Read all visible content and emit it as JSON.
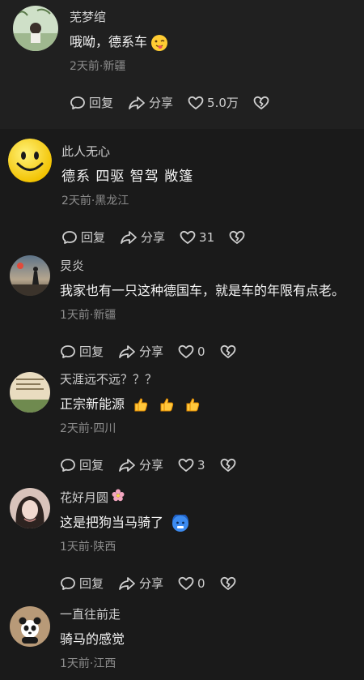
{
  "comments": [
    {
      "username": "芜梦绾",
      "text": "哦呦，德系车",
      "emoji": "wink-tongue-emoji",
      "time": "2天前",
      "location": "新疆",
      "reply": "回复",
      "share": "分享",
      "likes": "5.0万"
    },
    {
      "username": "此人无心",
      "text": "德系 四驱 智驾 敞篷",
      "time": "2天前",
      "location": "黑龙江",
      "reply": "回复",
      "share": "分享",
      "likes": "31"
    },
    {
      "username": "炅炎",
      "text": "我家也有一只这种德国车，就是车的年限有点老。",
      "time": "1天前",
      "location": "新疆",
      "reply": "回复",
      "share": "分享",
      "likes": "0"
    },
    {
      "username": "天涯远不远？？？",
      "text": "正宗新能源",
      "emoji": "thumbs-up-emoji",
      "time": "2天前",
      "location": "四川",
      "reply": "回复",
      "share": "分享",
      "likes": "3"
    },
    {
      "username": "花好月圆",
      "username_emoji": "cherry-blossom-emoji",
      "text": "这是把狗当马骑了",
      "emoji": "cold-face-emoji",
      "time": "1天前",
      "location": "陕西",
      "reply": "回复",
      "share": "分享",
      "likes": "0"
    },
    {
      "username": "一直往前走",
      "text": "骑马的感觉",
      "time": "1天前",
      "location": "江西"
    }
  ],
  "meta_separator": "·",
  "colors": {
    "background": "#1a1a1a",
    "highlight_row": "#202020",
    "text_primary": "#f5f5f5",
    "text_secondary": "#8c8c8c"
  }
}
